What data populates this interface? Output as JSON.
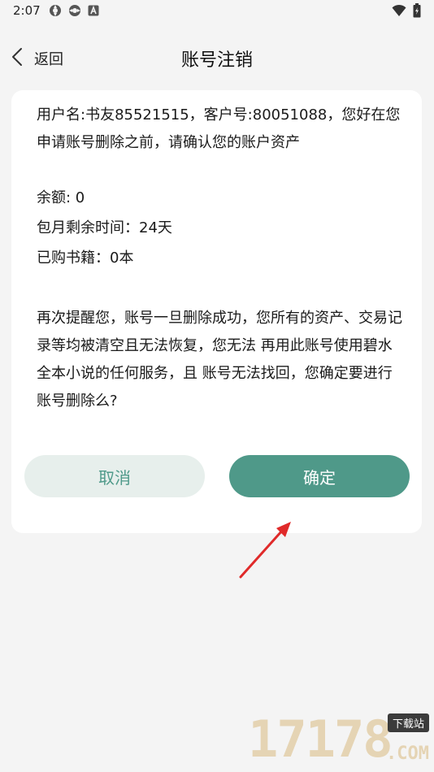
{
  "status_bar": {
    "time": "2:07",
    "icons": [
      "sync-icon",
      "sync-icon",
      "notification-a-icon",
      "wifi-icon",
      "battery-icon"
    ]
  },
  "nav": {
    "back_label": "返回",
    "title": "账号注销"
  },
  "account": {
    "intro": "用户名:书友85521515，客户号:80051088，您好在您申请账号删除之前，请确认您的账户资产",
    "balance": "余额: 0",
    "monthly_remaining": "包月剩余时间：24天",
    "purchased_books": "已购书籍：0本",
    "warning": "再次提醒您，账号一旦删除成功，您所有的资产、交易记录等均被清空且无法恢复，您无法 再用此账号使用碧水全本小说的任何服务，且 账号无法找回，您确定要进行账号删除么?"
  },
  "buttons": {
    "cancel_label": "取消",
    "confirm_label": "确定"
  },
  "watermark": {
    "digits": "17178",
    "badge": "下载站",
    "suffix": ".COM"
  },
  "colors": {
    "accent": "#4f9989",
    "cancel_bg": "#e7efec",
    "arrow": "#e02a2a"
  }
}
